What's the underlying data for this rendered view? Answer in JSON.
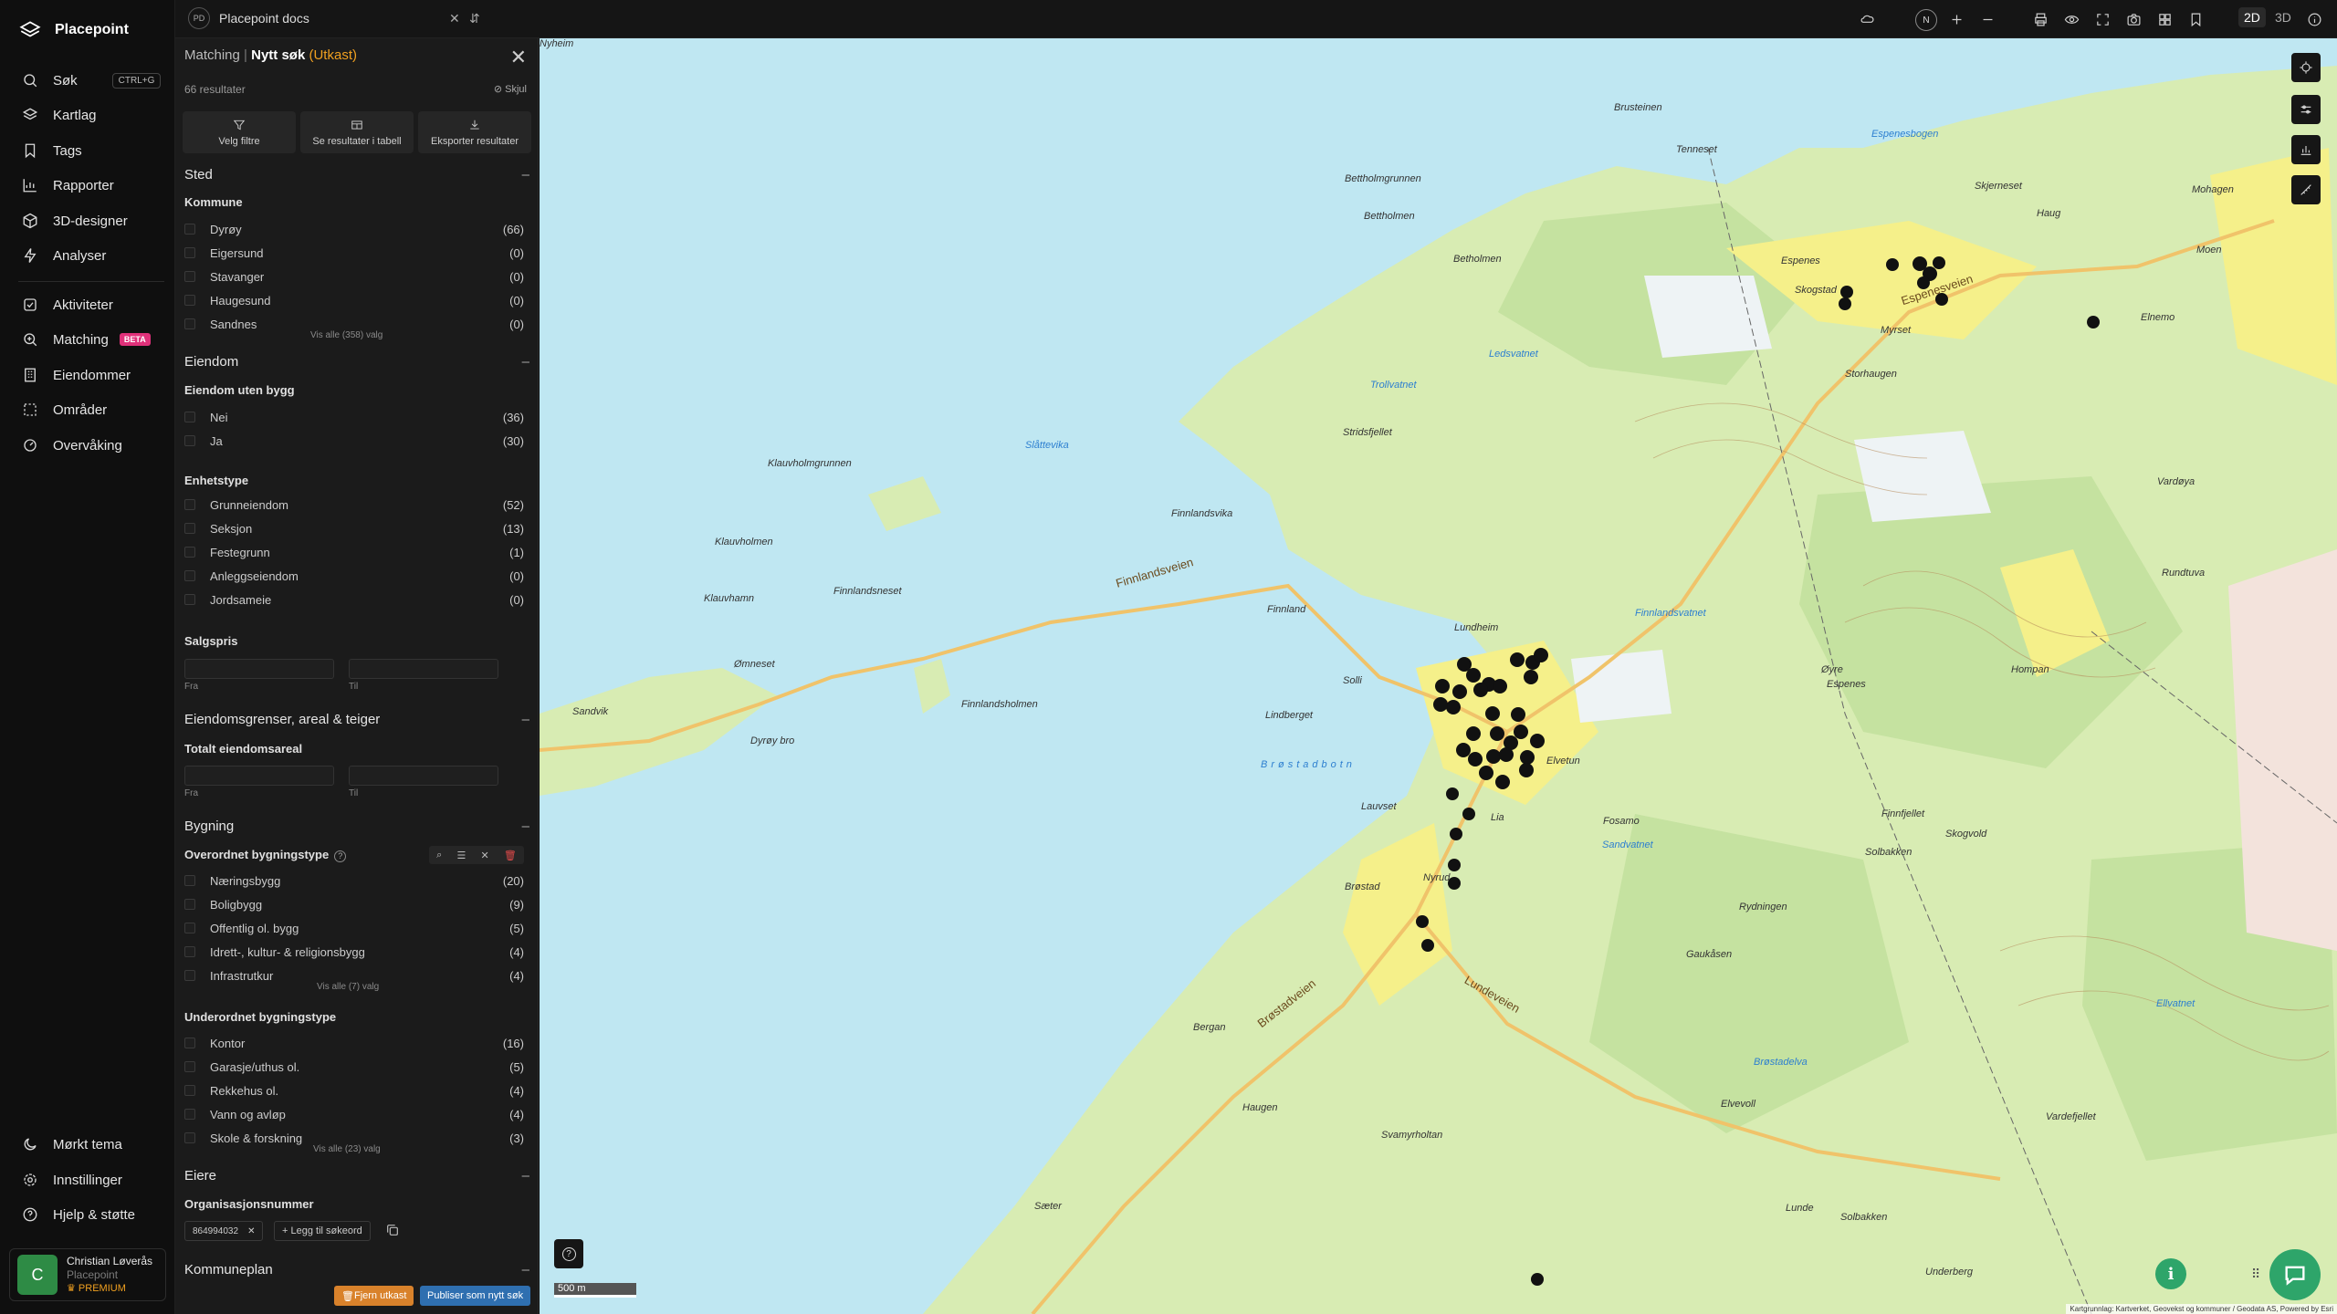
{
  "app": {
    "name": "Placepoint"
  },
  "nav": {
    "items_top": [
      {
        "label": "Søk",
        "shortcut": "CTRL+G",
        "icon": "search-icon"
      },
      {
        "label": "Kartlag",
        "icon": "layers-icon"
      },
      {
        "label": "Tags",
        "icon": "bookmark-icon"
      },
      {
        "label": "Rapporter",
        "icon": "chart-icon"
      },
      {
        "label": "3D-designer",
        "icon": "cube-icon"
      },
      {
        "label": "Analyser",
        "icon": "bolt-icon"
      }
    ],
    "items_mid": [
      {
        "label": "Aktiviteter",
        "icon": "activity-icon"
      },
      {
        "label": "Matching",
        "badge": "BETA",
        "icon": "match-icon"
      },
      {
        "label": "Eiendommer",
        "icon": "building-icon"
      },
      {
        "label": "Områder",
        "icon": "area-icon"
      },
      {
        "label": "Overvåking",
        "icon": "monitor-icon"
      }
    ],
    "items_bottom": [
      {
        "label": "Mørkt tema",
        "icon": "moon-icon"
      },
      {
        "label": "Innstillinger",
        "icon": "gear-icon"
      },
      {
        "label": "Hjelp & støtte",
        "icon": "help-icon"
      }
    ],
    "user": {
      "initial": "C",
      "name": "Christian Løverås",
      "org": "Placepoint",
      "tier": "PREMIUM"
    }
  },
  "topbar": {
    "workspace_logo": "PD",
    "workspace_name": "Placepoint docs",
    "view_2d": "2D",
    "view_3d": "3D",
    "north": "N"
  },
  "panel": {
    "crumb": "Matching",
    "title": "Nytt søk",
    "draft": "(Utkast)",
    "results": "66 resultater",
    "hide": "Skjul",
    "actions": [
      "Velg filtre",
      "Se resultater i tabell",
      "Eksporter resultater"
    ],
    "sted": {
      "title": "Sted",
      "group": "Kommune",
      "options": [
        {
          "label": "Dyrøy",
          "count": "(66)"
        },
        {
          "label": "Eigersund",
          "count": "(0)"
        },
        {
          "label": "Stavanger",
          "count": "(0)"
        },
        {
          "label": "Haugesund",
          "count": "(0)"
        },
        {
          "label": "Sandnes",
          "count": "(0)"
        }
      ],
      "see_all": "Vis alle (358) valg"
    },
    "eiendom": {
      "title": "Eiendom",
      "group1": "Eiendom uten bygg",
      "options1": [
        {
          "label": "Nei",
          "count": "(36)"
        },
        {
          "label": "Ja",
          "count": "(30)"
        }
      ],
      "group2": "Enhetstype",
      "options2": [
        {
          "label": "Grunneiendom",
          "count": "(52)"
        },
        {
          "label": "Seksjon",
          "count": "(13)"
        },
        {
          "label": "Festegrunn",
          "count": "(1)"
        },
        {
          "label": "Anleggseiendom",
          "count": "(0)"
        },
        {
          "label": "Jordsameie",
          "count": "(0)"
        }
      ],
      "group3": "Salgspris",
      "from": "Fra",
      "to": "Til"
    },
    "grenser": {
      "title": "Eiendomsgrenser, areal & teiger",
      "group": "Totalt eiendomsareal",
      "from": "Fra",
      "to": "Til"
    },
    "bygning": {
      "title": "Bygning",
      "group1": "Overordnet bygningstype",
      "options1": [
        {
          "label": "Næringsbygg",
          "count": "(20)"
        },
        {
          "label": "Boligbygg",
          "count": "(9)"
        },
        {
          "label": "Offentlig ol. bygg",
          "count": "(5)"
        },
        {
          "label": "Idrett-, kultur- & religionsbygg",
          "count": "(4)"
        },
        {
          "label": "Infrastrutkur",
          "count": "(4)"
        }
      ],
      "see_all1": "Vis alle (7) valg",
      "group2": "Underordnet bygningstype",
      "options2": [
        {
          "label": "Kontor",
          "count": "(16)"
        },
        {
          "label": "Garasje/uthus ol.",
          "count": "(5)"
        },
        {
          "label": "Rekkehus ol.",
          "count": "(4)"
        },
        {
          "label": "Vann og avløp",
          "count": "(4)"
        },
        {
          "label": "Skole & forskning",
          "count": "(3)"
        }
      ],
      "see_all2": "Vis alle (23) valg"
    },
    "eiere": {
      "title": "Eiere",
      "group": "Organisasjonsnummer",
      "chip": "864994032",
      "add_keyword": "Legg til søkeord"
    },
    "kommuneplan": {
      "title": "Kommuneplan"
    },
    "btn_remove": "Fjern utkast",
    "btn_publish": "Publiser som nytt søk"
  },
  "map": {
    "scale": "500 m",
    "attribution": "Kartgrunnlag: Kartverket, Geovekst og kommuner / Geodata AS, Powered by Esri",
    "colors": {
      "water": "#bfe7f2",
      "land": "#d8ecb3",
      "forest": "#c5e2a0",
      "field": "#f5f08a",
      "marker": "#111111",
      "accent": "#2ea56a"
    },
    "places": [
      {
        "name": "Brusteinen",
        "kind": "land"
      },
      {
        "name": "Tenneset",
        "kind": "land"
      },
      {
        "name": "Espenesbogen",
        "kind": "water"
      },
      {
        "name": "Bettholmgrunnen",
        "kind": "land"
      },
      {
        "name": "Bettholmen",
        "kind": "land"
      },
      {
        "name": "Betholmen",
        "kind": "land"
      },
      {
        "name": "Skjerneset",
        "kind": "land"
      },
      {
        "name": "Haug",
        "kind": "land"
      },
      {
        "name": "Espenes",
        "kind": "land"
      },
      {
        "name": "Skogstad",
        "kind": "land"
      },
      {
        "name": "Espenesveien",
        "kind": "road"
      },
      {
        "name": "Myrset",
        "kind": "land"
      },
      {
        "name": "Storhaugen",
        "kind": "land"
      },
      {
        "name": "Ledsvatnet",
        "kind": "water"
      },
      {
        "name": "Trollvatnet",
        "kind": "water"
      },
      {
        "name": "Stridsfjellet",
        "kind": "land"
      },
      {
        "name": "Slåttevika",
        "kind": "water"
      },
      {
        "name": "Klauvholmgrunnen",
        "kind": "land"
      },
      {
        "name": "Finnlandsvika",
        "kind": "land"
      },
      {
        "name": "Finnlandsveien",
        "kind": "road"
      },
      {
        "name": "Klauvholmen",
        "kind": "land"
      },
      {
        "name": "Finnlandsneset",
        "kind": "land"
      },
      {
        "name": "Klauvhamn",
        "kind": "land"
      },
      {
        "name": "Ømneset",
        "kind": "land"
      },
      {
        "name": "Finnlandsholmen",
        "kind": "land"
      },
      {
        "name": "Sandvik",
        "kind": "land"
      },
      {
        "name": "Dyrøy bro",
        "kind": "land"
      },
      {
        "name": "Finnland",
        "kind": "land"
      },
      {
        "name": "Lundheim",
        "kind": "land"
      },
      {
        "name": "Solli",
        "kind": "land"
      },
      {
        "name": "Lindberget",
        "kind": "land"
      },
      {
        "name": "Brøstadbotn",
        "kind": "water"
      },
      {
        "name": "Finnlandsvatnet",
        "kind": "water"
      },
      {
        "name": "Elvetun",
        "kind": "land"
      },
      {
        "name": "Fosamo",
        "kind": "land"
      },
      {
        "name": "Lia",
        "kind": "land"
      },
      {
        "name": "Lauvset",
        "kind": "land"
      },
      {
        "name": "Nyrud",
        "kind": "land"
      },
      {
        "name": "Brøstad",
        "kind": "land"
      },
      {
        "name": "Brøstadveien",
        "kind": "road"
      },
      {
        "name": "Lundeveien",
        "kind": "road"
      },
      {
        "name": "Bergan",
        "kind": "land"
      },
      {
        "name": "Haugen",
        "kind": "land"
      },
      {
        "name": "Svamyrholtan",
        "kind": "land"
      },
      {
        "name": "Sæter",
        "kind": "land"
      },
      {
        "name": "Lunde",
        "kind": "land"
      },
      {
        "name": "Solbakken",
        "kind": "land"
      },
      {
        "name": "Underberg",
        "kind": "land"
      },
      {
        "name": "Sandvatnet",
        "kind": "water"
      },
      {
        "name": "Rydningen",
        "kind": "land"
      },
      {
        "name": "Gaukåsen",
        "kind": "land"
      },
      {
        "name": "Nyheim",
        "kind": "land"
      },
      {
        "name": "Solbakken",
        "kind": "land"
      },
      {
        "name": "Skogvold",
        "kind": "land"
      },
      {
        "name": "Finnfjellet",
        "kind": "land"
      },
      {
        "name": "Øyre",
        "kind": "land"
      },
      {
        "name": "Espenes",
        "kind": "land"
      },
      {
        "name": "Hompan",
        "kind": "land"
      },
      {
        "name": "Vardøya",
        "kind": "land"
      },
      {
        "name": "Rundtuva",
        "kind": "land"
      },
      {
        "name": "Ellvatnet",
        "kind": "water"
      },
      {
        "name": "Mohagen",
        "kind": "land"
      },
      {
        "name": "Moen",
        "kind": "land"
      },
      {
        "name": "Elnemo",
        "kind": "land"
      },
      {
        "name": "Vardefjellet",
        "kind": "land"
      },
      {
        "name": "Elvevoll",
        "kind": "land"
      },
      {
        "name": "Brøstadelva",
        "kind": "water"
      }
    ]
  }
}
